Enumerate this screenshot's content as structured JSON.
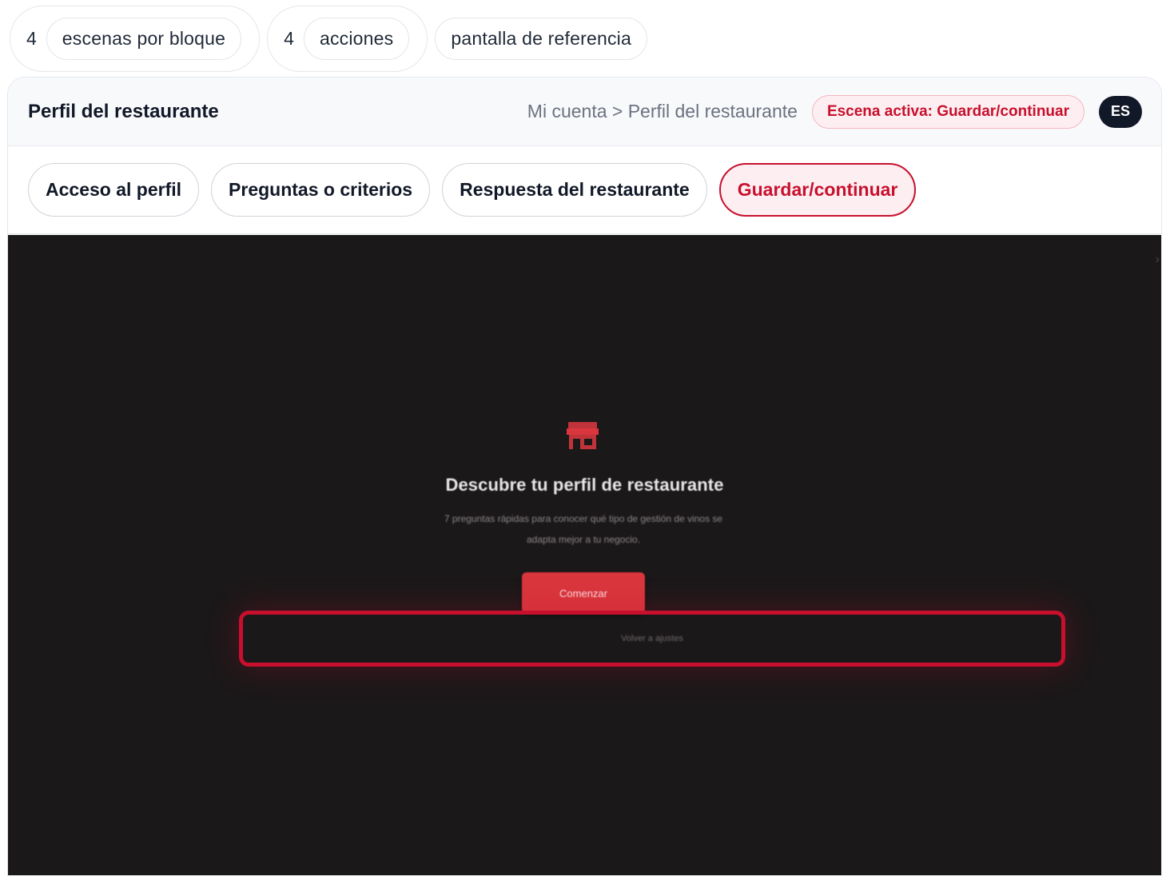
{
  "stats": {
    "scenes": {
      "count": "4",
      "label": "escenas por bloque"
    },
    "actions": {
      "count": "4",
      "label": "acciones"
    },
    "reference": "pantalla de referencia"
  },
  "header": {
    "title": "Perfil del restaurante",
    "breadcrumb": "Mi cuenta > Perfil del restaurante",
    "active_scene": "Escena activa: Guardar/continuar",
    "language": "ES"
  },
  "tabs": [
    {
      "label": "Acceso al perfil",
      "active": false
    },
    {
      "label": "Preguntas o criterios",
      "active": false
    },
    {
      "label": "Respuesta del restaurante",
      "active": false
    },
    {
      "label": "Guardar/continuar",
      "active": true
    }
  ],
  "screen": {
    "icon": "store-icon",
    "title": "Descubre tu perfil de restaurante",
    "description": "7 preguntas rápidas para conocer qué tipo de gestión de vinos se adapta mejor a tu negocio.",
    "start_button": "Comenzar",
    "back_link": "Volver a ajustes",
    "close_glyph": "›"
  },
  "colors": {
    "accent": "#c8102e",
    "screen_bg": "#1b1819",
    "button_red": "#d9363d"
  }
}
